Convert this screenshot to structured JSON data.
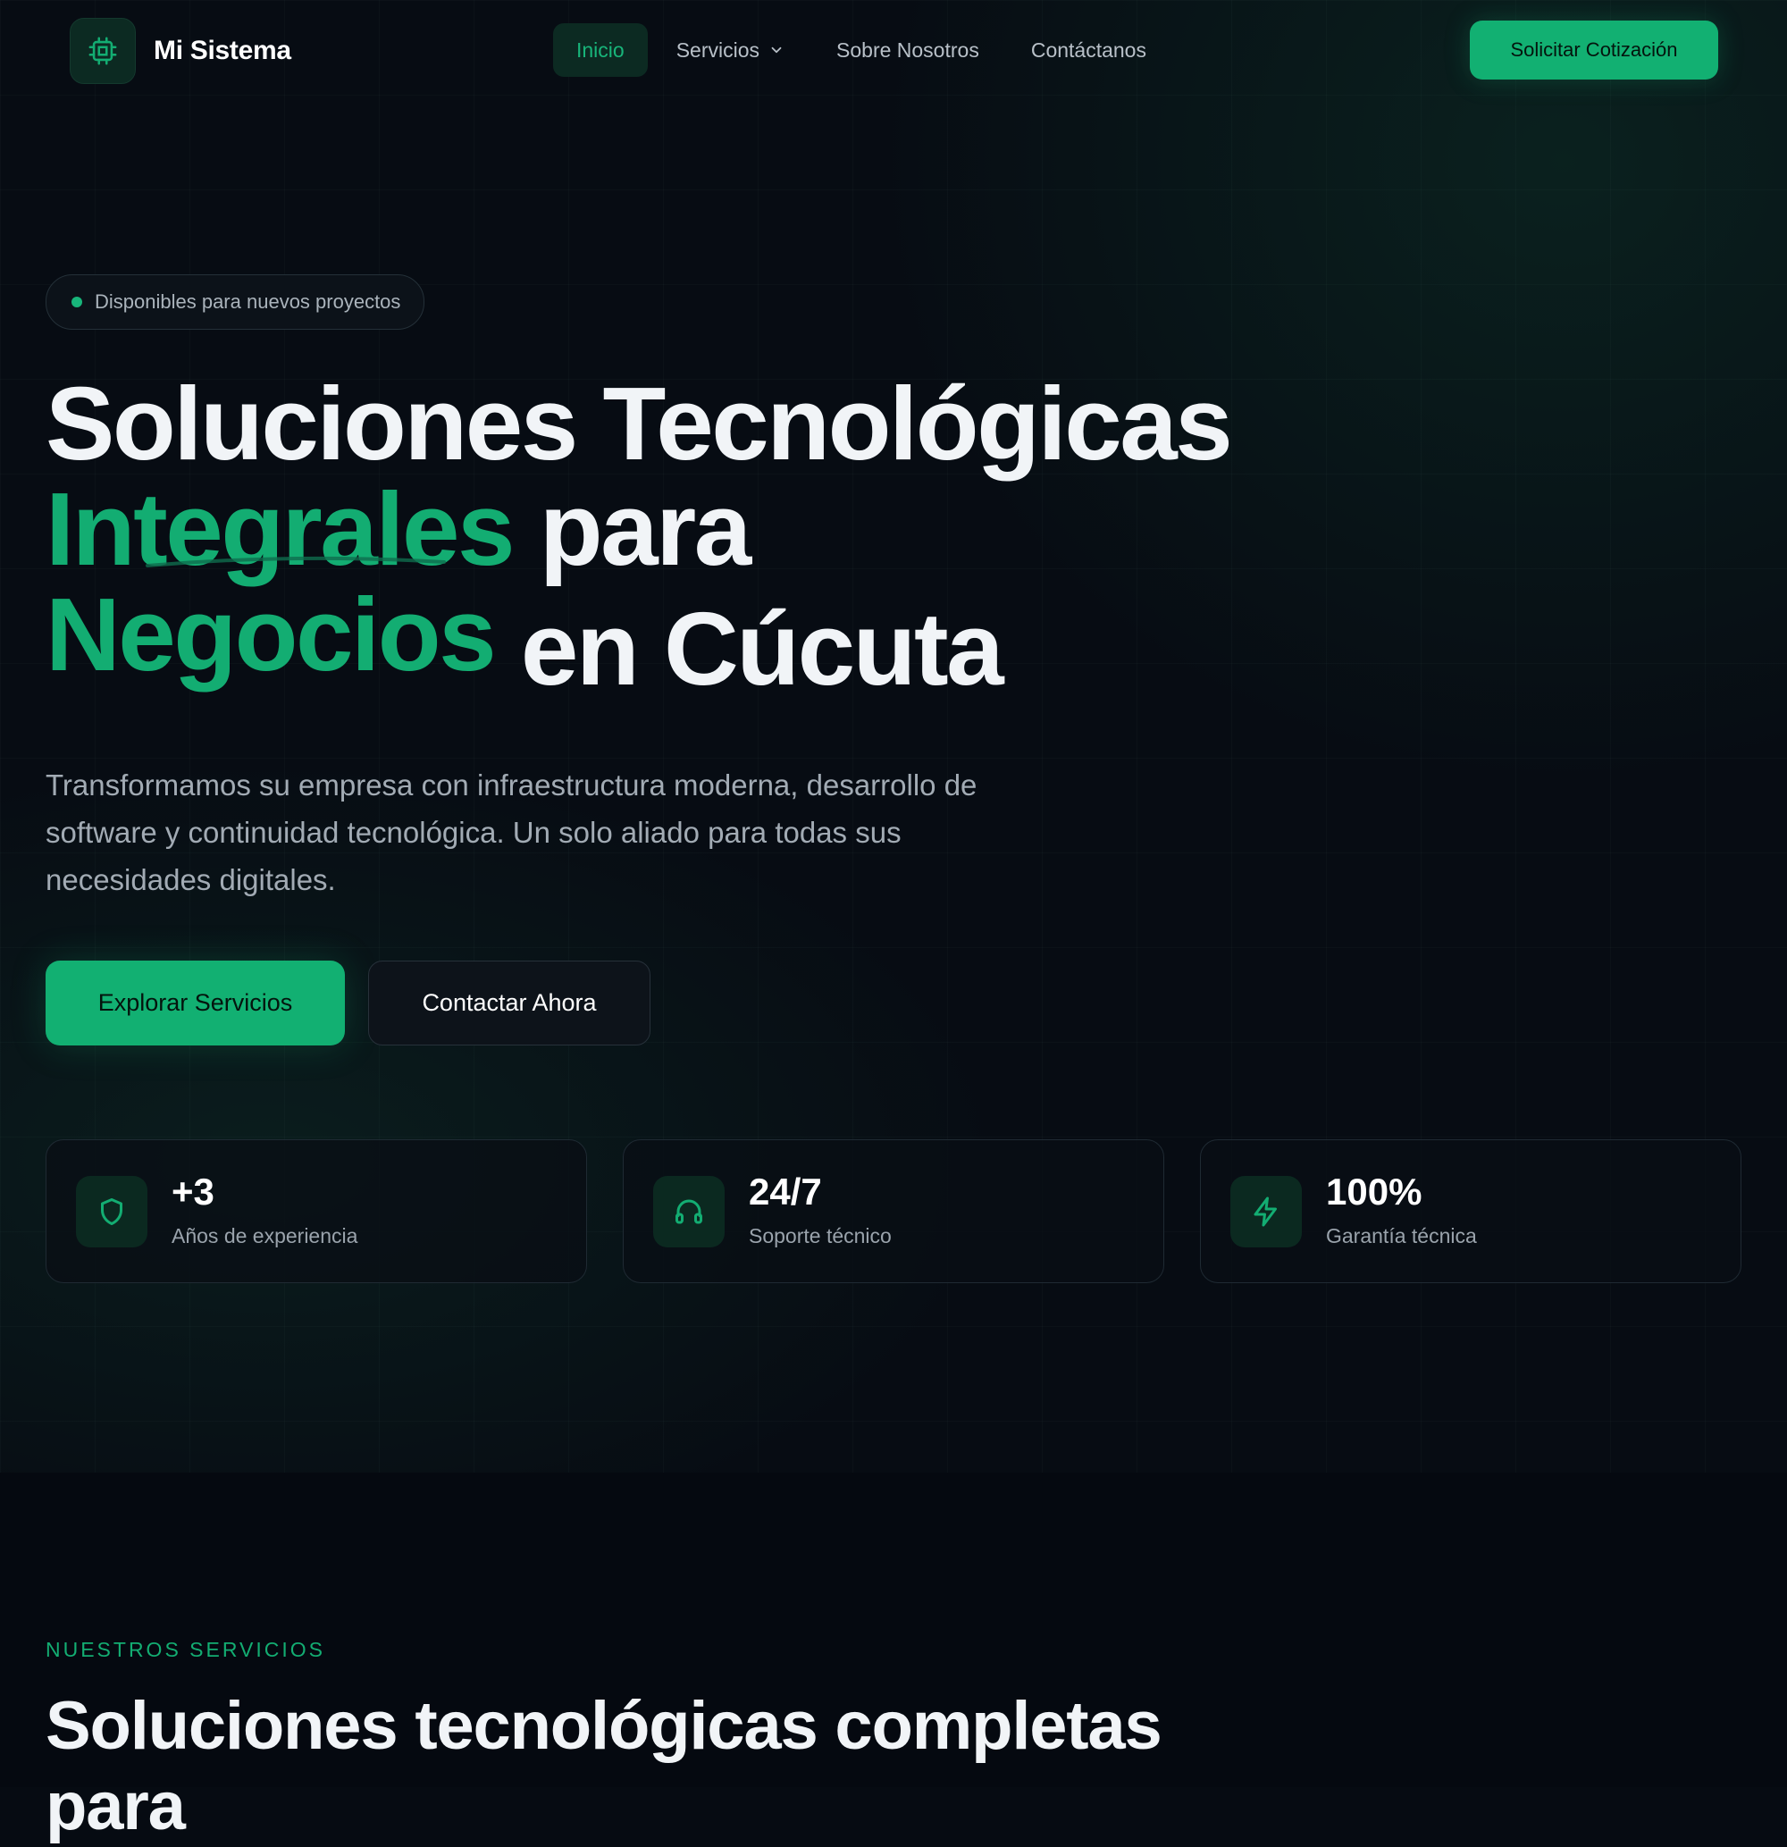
{
  "nav": {
    "brand": "Mi Sistema",
    "links": [
      {
        "label": "Inicio",
        "active": true
      },
      {
        "label": "Servicios",
        "active": false
      },
      {
        "label": "Sobre Nosotros",
        "active": false
      },
      {
        "label": "Contáctanos",
        "active": false
      }
    ],
    "cta": "Solicitar Cotización"
  },
  "hero": {
    "badge": "Disponibles para nuevos proyectos",
    "headline": {
      "line1": "Soluciones Tecnológicas",
      "line2_green": "Integrales",
      "line2_rest": "para",
      "line3_green": "Negocios",
      "line3_rest": "en Cúcuta"
    },
    "lead": "Transformamos su empresa con infraestructura moderna, desarrollo de software y continuidad tecnológica. Un solo aliado para todas sus necesidades digitales.",
    "primary_button": "Explorar Servicios",
    "secondary_button": "Contactar Ahora"
  },
  "stats": [
    {
      "icon": "shield-icon",
      "value": "+3",
      "label": "Años de experiencia"
    },
    {
      "icon": "headphones-icon",
      "value": "24/7",
      "label": "Soporte técnico"
    },
    {
      "icon": "lightning-icon",
      "value": "100%",
      "label": "Garantía técnica"
    }
  ],
  "services": {
    "eyebrow": "NUESTROS SERVICIOS",
    "title": "Soluciones tecnológicas completas para"
  },
  "colors": {
    "accent": "#13ad72",
    "background": "#060b12",
    "icon_tile": "#0b2920"
  }
}
